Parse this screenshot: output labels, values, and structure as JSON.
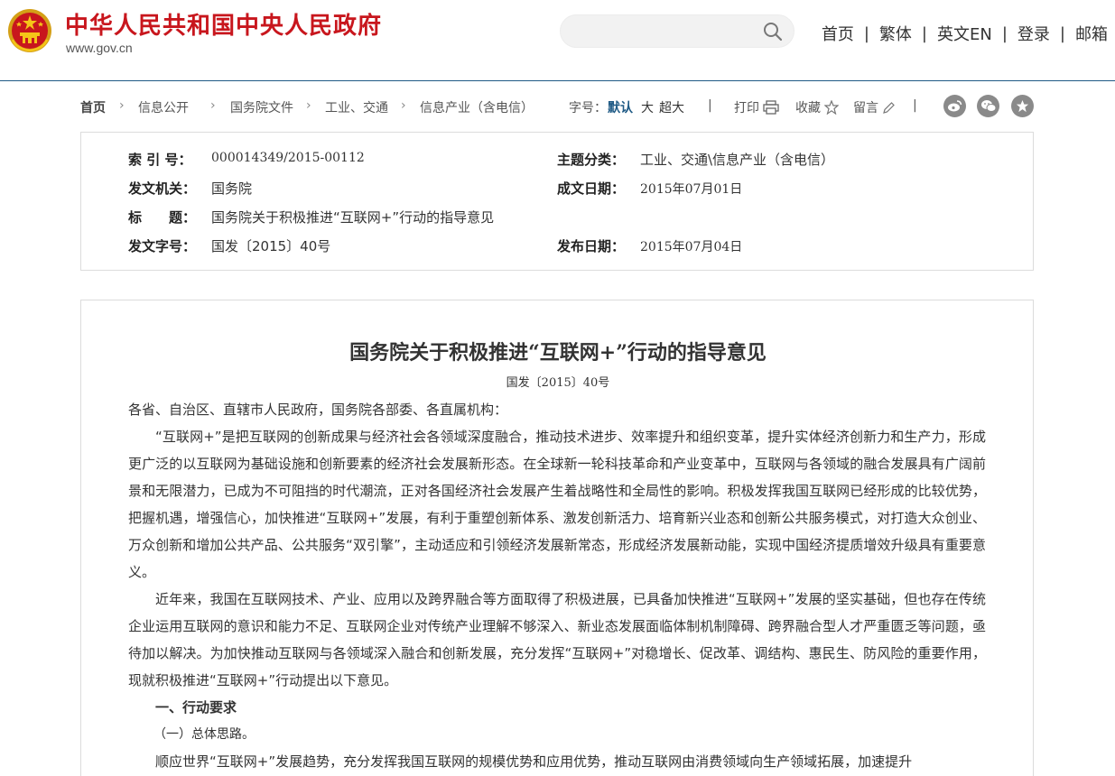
{
  "header": {
    "site_name": "中华人民共和国中央人民政府",
    "site_url": "www.gov.cn",
    "search": {
      "value": "",
      "placeholder": ""
    },
    "nav": [
      {
        "label": "首页"
      },
      {
        "label": "繁体"
      },
      {
        "label": "英文EN"
      },
      {
        "label": "登录"
      },
      {
        "label": "邮箱"
      }
    ],
    "nav_separator": "|"
  },
  "toolbar": {
    "breadcrumb": [
      "首页",
      "信息公开",
      "国务院文件",
      "工业、交通",
      "信息产业（含电信）"
    ],
    "font_size_label": "字号：",
    "font_sizes": [
      "默认",
      "大",
      "超大"
    ],
    "font_size_active": "默认",
    "print_label": "打印",
    "favorite_label": "收藏",
    "comment_label": "留言",
    "separator": "|",
    "colors": {
      "active": "#1f5a85",
      "share_icon_bg": "#8a8a8a"
    }
  },
  "metadata": {
    "index_no": {
      "label": "索 引 号：",
      "value": "000014349/2015-00112"
    },
    "category": {
      "label": "主题分类：",
      "value": "工业、交通\\信息产业（含电信）"
    },
    "issuer": {
      "label": "发文机关：",
      "value": "国务院"
    },
    "created_date": {
      "label": "成文日期：",
      "value": "2015年07月01日"
    },
    "title": {
      "label": "标　　题：",
      "value": "国务院关于积极推进“互联网+”行动的指导意见"
    },
    "doc_no": {
      "label": "发文字号：",
      "value": "国发〔2015〕40号"
    },
    "published_date": {
      "label": "发布日期：",
      "value": "2015年07月04日"
    }
  },
  "article": {
    "title": "国务院关于积极推进“互联网+”行动的指导意见",
    "doc_number": "国发〔2015〕40号",
    "salutation": "各省、自治区、直辖市人民政府，国务院各部委、各直属机构：",
    "paragraphs": [
      "“互联网+”是把互联网的创新成果与经济社会各领域深度融合，推动技术进步、效率提升和组织变革，提升实体经济创新力和生产力，形成更广泛的以互联网为基础设施和创新要素的经济社会发展新形态。在全球新一轮科技革命和产业变革中，互联网与各领域的融合发展具有广阔前景和无限潜力，已成为不可阻挡的时代潮流，正对各国经济社会发展产生着战略性和全局性的影响。积极发挥我国互联网已经形成的比较优势，把握机遇，增强信心，加快推进“互联网+”发展，有利于重塑创新体系、激发创新活力、培育新兴业态和创新公共服务模式，对打造大众创业、万众创新和增加公共产品、公共服务“双引擎”，主动适应和引领经济发展新常态，形成经济发展新动能，实现中国经济提质增效升级具有重要意义。",
      "近年来，我国在互联网技术、产业、应用以及跨界融合等方面取得了积极进展，已具备加快推进“互联网+”发展的坚实基础，但也存在传统企业运用互联网的意识和能力不足、互联网企业对传统产业理解不够深入、新业态发展面临体制机制障碍、跨界融合型人才严重匮乏等问题，亟待加以解决。为加快推动互联网与各领域深入融合和创新发展，充分发挥“互联网+”对稳增长、促改革、调结构、惠民生、防风险的重要作用，现就积极推进“互联网+”行动提出以下意见。"
    ],
    "section1": "一、行动要求",
    "subsection1": "（一）总体思路。",
    "paragraph3": "顺应世界“互联网+”发展趋势，充分发挥我国互联网的规模优势和应用优势，推动互联网由消费领域向生产领域拓展，加速提升"
  }
}
